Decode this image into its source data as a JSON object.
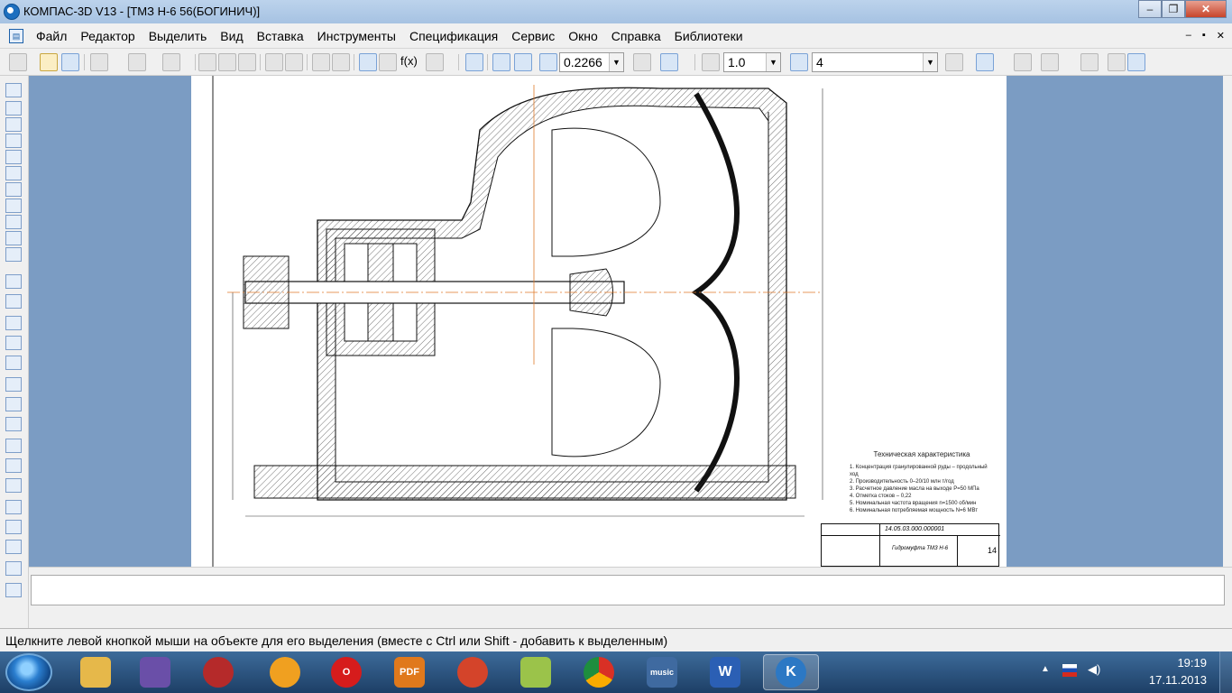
{
  "window": {
    "title": "КОМПАС-3D V13 - [ТМЗ Н-6 56(БОГИНИЧ)]",
    "minimize": "–",
    "maximize": "❐",
    "close": "✕"
  },
  "menu": {
    "items": [
      "Файл",
      "Редактор",
      "Выделить",
      "Вид",
      "Вставка",
      "Инструменты",
      "Спецификация",
      "Сервис",
      "Окно",
      "Справка",
      "Библиотеки"
    ],
    "mdi_min": "–",
    "mdi_restore": "▪",
    "mdi_close": "✕"
  },
  "toolbar": {
    "zoom_value": "0.2266",
    "line_scale": "1.0",
    "layer_value": "4",
    "fx_label": "f(x)"
  },
  "drawing": {
    "tech_title": "Техническая характеристика",
    "tech_lines": [
      "1. Концентрация гранулированной руды – продольный ход",
      "2. Производительность  0–20/10 млн т/год",
      "3. Расчетное давление масла на выходе P=50 МПа",
      "4. Отметка стоков – 0,22",
      "5. Номинальная частота вращения n=1500 об/мин",
      "6. Номинальная потребляемая мощность N=6 МВт"
    ],
    "stamp_code": "14.05.03.000.000001",
    "stamp_name": "Гидромуфта ТМЗ Н-6",
    "stamp_sheet": "14"
  },
  "statusbar": {
    "hint": "Щелкните левой кнопкой мыши на объекте для его выделения (вместе с Ctrl или Shift - добавить к выделенным)"
  },
  "taskbar": {
    "apps": [
      {
        "name": "explorer",
        "label": "",
        "color": "#e6b84a"
      },
      {
        "name": "visual-studio",
        "label": "",
        "color": "#6a4fa8"
      },
      {
        "name": "steam-like",
        "label": "",
        "color": "#b52a2a"
      },
      {
        "name": "daemon-tools",
        "label": "",
        "color": "#f0a020"
      },
      {
        "name": "opera",
        "label": "O",
        "color": "#d61c1c"
      },
      {
        "name": "pdf",
        "label": "PDF",
        "color": "#e0791c"
      },
      {
        "name": "ccleaner",
        "label": "",
        "color": "#d4442a"
      },
      {
        "name": "sticky",
        "label": "",
        "color": "#9bc34a"
      },
      {
        "name": "chrome",
        "label": "",
        "color": "#3aa14b"
      },
      {
        "name": "vk-music",
        "label": "music",
        "color": "#3f6aa0"
      },
      {
        "name": "word",
        "label": "W",
        "color": "#2b5fb4"
      },
      {
        "name": "kompas",
        "label": "K",
        "color": "#2c78c4"
      }
    ],
    "clock_time": "19:19",
    "clock_date": "17.11.2013"
  }
}
